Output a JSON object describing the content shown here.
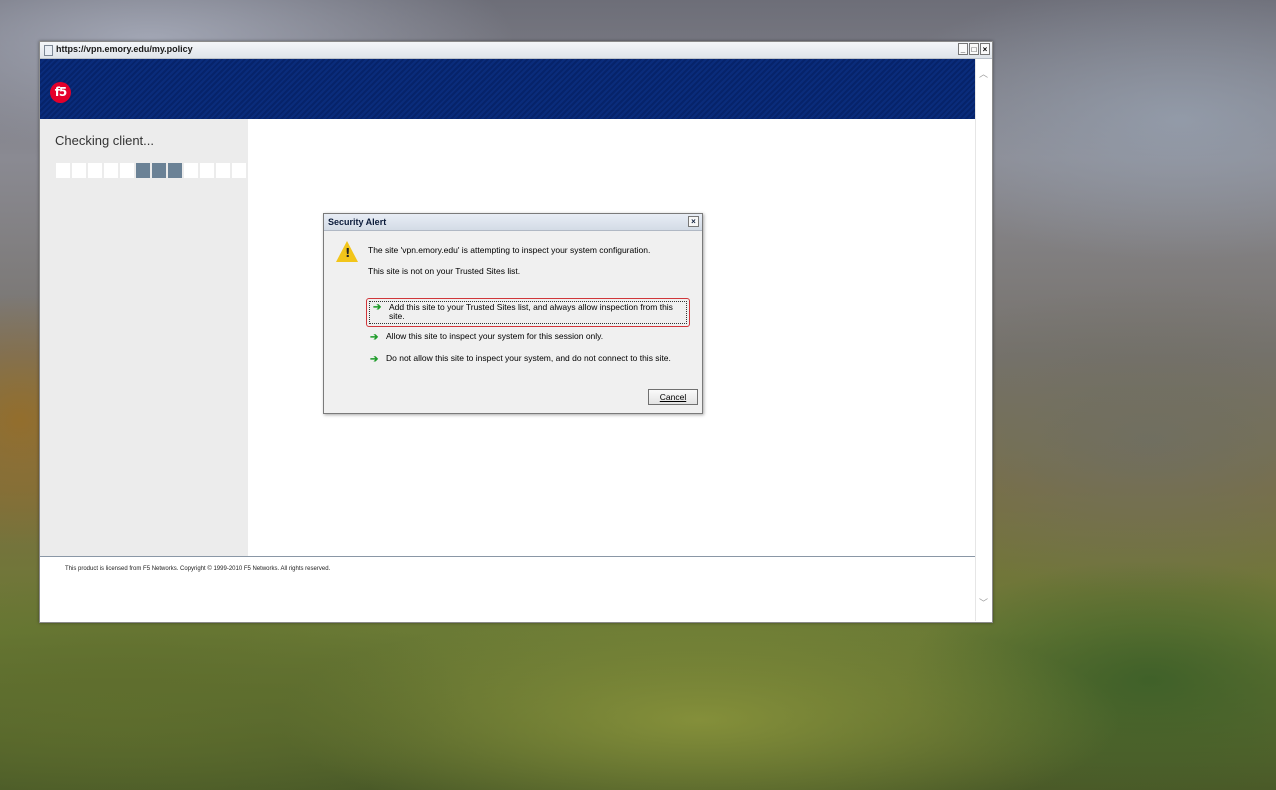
{
  "window": {
    "title": "https://vpn.emory.edu/my.policy",
    "controls": {
      "minimize": "_",
      "maximize": "□",
      "close": "×"
    }
  },
  "banner": {
    "logo_text": "f5",
    "brand_color": "#e4002b",
    "bg_color": "#0a2c7b"
  },
  "sidebar": {
    "status_text": "Checking client...",
    "progress_blocks": [
      false,
      false,
      false,
      false,
      false,
      true,
      true,
      true,
      false,
      false,
      false,
      false
    ]
  },
  "footer": {
    "copyright": "This product is licensed from F5 Networks. Copyright © 1999-2010 F5 Networks. All rights reserved."
  },
  "dialog": {
    "title": "Security Alert",
    "close_label": "×",
    "warning_icon": "warning-triangle-icon",
    "message": "The site 'vpn.emory.edu' is attempting to inspect your system configuration.",
    "submessage": "This site is not on your Trusted Sites list.",
    "options": [
      {
        "label": "Add this site to your Trusted Sites list, and always allow inspection from this site.",
        "highlighted": true
      },
      {
        "label": "Allow this site to inspect your system for this session only.",
        "highlighted": false
      },
      {
        "label": "Do not allow this site to inspect your system, and do not connect to this site.",
        "highlighted": false
      }
    ],
    "cancel_label": "Cancel"
  }
}
